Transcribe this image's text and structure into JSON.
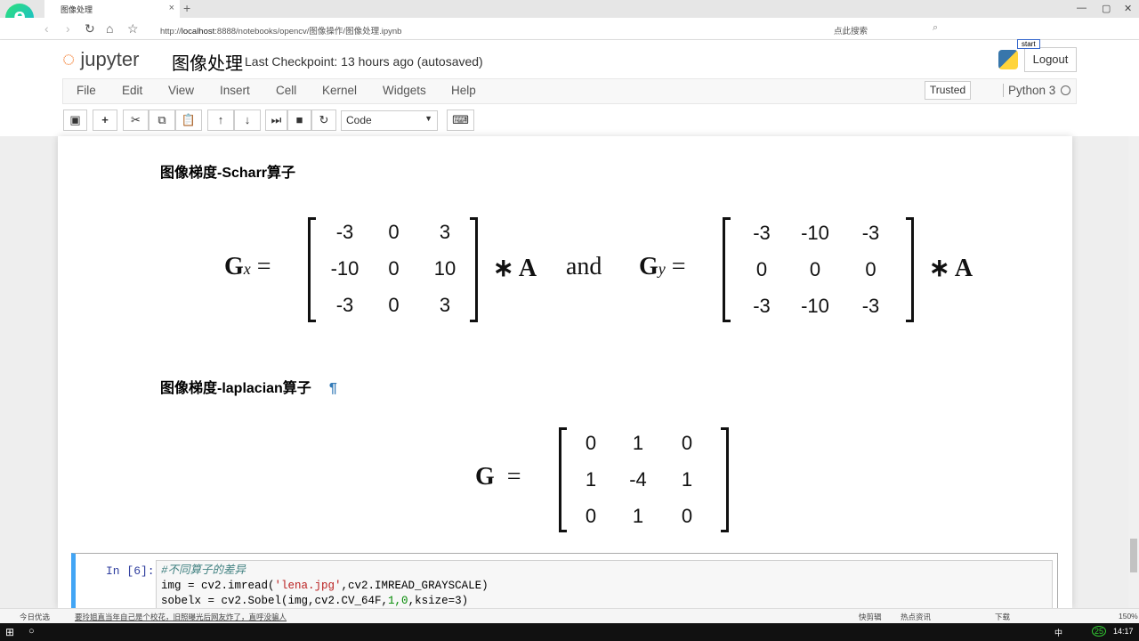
{
  "browser": {
    "tab_title": "图像处理",
    "new_tab": "+",
    "close": "×",
    "url_prefix": "http://",
    "url_host": "localhost",
    "url_rest": ":8888/notebooks/opencv/图像操作/图像处理.ipynb",
    "search_placeholder": "点此搜索",
    "window_controls": [
      "—",
      "▢",
      "✕"
    ]
  },
  "jupyter": {
    "logo_text": "jupyter",
    "notebook_title": "图像处理",
    "checkpoint": "Last Checkpoint: 13 hours ago (autosaved)",
    "logout": "Logout",
    "start": "start",
    "menu": [
      "File",
      "Edit",
      "View",
      "Insert",
      "Cell",
      "Kernel",
      "Widgets",
      "Help"
    ],
    "trusted": "Trusted",
    "kernel": "Python 3",
    "cell_type": "Code"
  },
  "toolbar_icons": [
    "save-icon",
    "plus-icon",
    "cut-icon",
    "copy-icon",
    "paste-icon",
    "arrow-up-icon",
    "arrow-down-icon",
    "run-icon",
    "stop-icon",
    "restart-icon",
    "keyboard-icon"
  ],
  "content": {
    "heading1": "图像梯度-Scharr算子",
    "heading2": "图像梯度-laplacian算子",
    "pilcrow": "¶",
    "gx_label": "G",
    "gx_sub": "x",
    "gy_label": "G",
    "gy_sub": "y",
    "eq": "=",
    "times_a": "∗ A",
    "and": "and",
    "g_label": "G",
    "gx": [
      "-3",
      "0",
      "3",
      "-10",
      "0",
      "10",
      "-3",
      "0",
      "3"
    ],
    "gy": [
      "-3",
      "-10",
      "-3",
      "0",
      "0",
      "0",
      "-3",
      "-10",
      "-3"
    ],
    "g": [
      "0",
      "1",
      "0",
      "1",
      "-4",
      "1",
      "0",
      "1",
      "0"
    ]
  },
  "cell": {
    "prompt": "In [6]:",
    "comment": "#不同算子的差异",
    "line2a": "img = cv2.imread(",
    "line2s": "'lena.jpg'",
    "line2b": ",cv2.IMREAD_GRAYSCALE)",
    "line3a": "sobelx = cv2.Sobel(img,cv2.CV_64F,",
    "line3n": "1,0",
    "line3b": ",ksize=3)"
  },
  "statusbar": {
    "left": "今日优选",
    "news": "要玲姐直当年自己是个校花，旧照曝光后网友炸了，直呼没骗人",
    "right": [
      "快剪辑",
      "热点资讯",
      "下载",
      "150%"
    ]
  },
  "taskbar": {
    "ime": "中",
    "badge": "25",
    "time": "14:17"
  }
}
